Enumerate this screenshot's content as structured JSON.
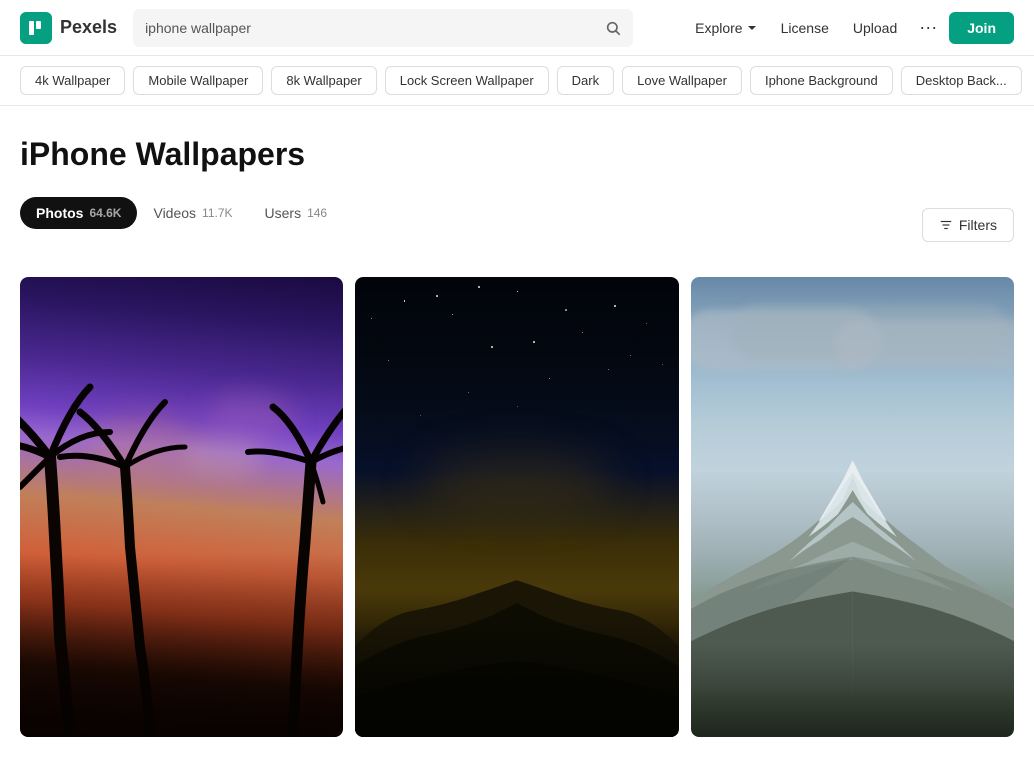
{
  "header": {
    "logo_text": "Pexels",
    "logo_letter": "P",
    "search_placeholder": "iphone wallpaper",
    "search_value": "iphone wallpaper",
    "nav": {
      "explore_label": "Explore",
      "license_label": "License",
      "upload_label": "Upload",
      "more_label": "···",
      "join_label": "Join"
    }
  },
  "tags": [
    {
      "id": "4k",
      "label": "4k Wallpaper"
    },
    {
      "id": "mobile",
      "label": "Mobile Wallpaper"
    },
    {
      "id": "8k",
      "label": "8k Wallpaper"
    },
    {
      "id": "lock",
      "label": "Lock Screen Wallpaper"
    },
    {
      "id": "dark",
      "label": "Dark"
    },
    {
      "id": "love",
      "label": "Love Wallpaper"
    },
    {
      "id": "iphone",
      "label": "Iphone Background"
    },
    {
      "id": "desktop",
      "label": "Desktop Back..."
    }
  ],
  "page": {
    "title": "iPhone Wallpapers",
    "tabs": [
      {
        "id": "photos",
        "label": "Photos",
        "count": "64.6K",
        "active": true
      },
      {
        "id": "videos",
        "label": "Videos",
        "count": "11.7K",
        "active": false
      },
      {
        "id": "users",
        "label": "Users",
        "count": "146",
        "active": false
      }
    ],
    "filters_label": "Filters"
  },
  "photos": [
    {
      "id": 1,
      "alt": "Palm trees against sunset sky"
    },
    {
      "id": 2,
      "alt": "Mountains under night sky with stars"
    },
    {
      "id": 3,
      "alt": "Snow-capped mountain peak"
    }
  ],
  "colors": {
    "brand": "#05a081",
    "active_tab_bg": "#111111"
  }
}
